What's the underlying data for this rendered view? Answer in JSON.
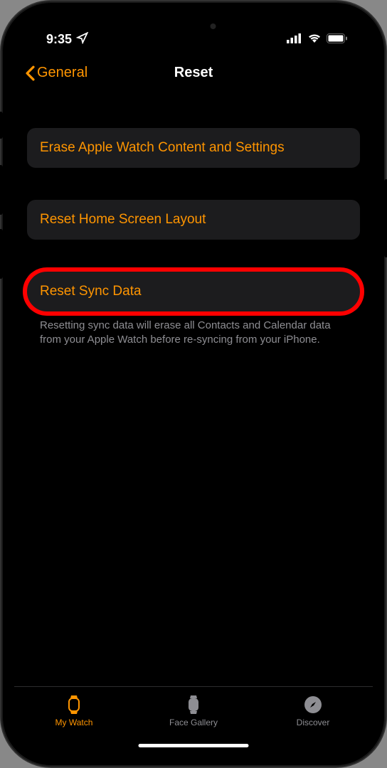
{
  "status": {
    "time": "9:35",
    "location_glyph": "➤"
  },
  "nav": {
    "back_label": "General",
    "title": "Reset"
  },
  "buttons": {
    "erase": "Erase Apple Watch Content and Settings",
    "reset_home": "Reset Home Screen Layout",
    "reset_sync": "Reset Sync Data"
  },
  "footer": "Resetting sync data will erase all Contacts and Calendar data from your Apple Watch before re-syncing from your iPhone.",
  "tabs": {
    "my_watch": "My Watch",
    "face_gallery": "Face Gallery",
    "discover": "Discover"
  },
  "colors": {
    "accent": "#ff9500",
    "highlight_ring": "#ff0000"
  }
}
